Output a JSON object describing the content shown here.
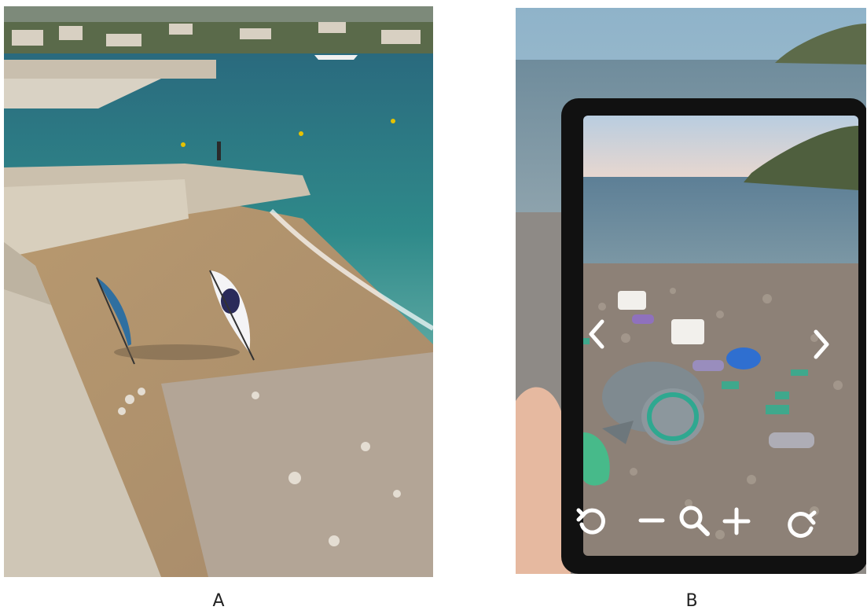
{
  "panels": [
    {
      "id": "A",
      "caption": "A",
      "description_scene": "beach-photo-with-flags"
    },
    {
      "id": "B",
      "caption": "B",
      "description_scene": "tablet-ar-view"
    }
  ],
  "ar_controls": {
    "prev_icon": "chevron-left-icon",
    "next_icon": "chevron-right-icon",
    "rotate_left_icon": "rotate-ccw-icon",
    "zoom_out_icon": "minus-icon",
    "zoom_icon": "magnifier-icon",
    "zoom_in_icon": "plus-icon",
    "rotate_right_icon": "rotate-cw-icon",
    "control_color": "#ffffff"
  },
  "colors": {
    "sea_deep": "#1f5f73",
    "sea_shallow": "#2f8a8a",
    "sand": "#b89a76",
    "pebbles": "#a39686",
    "stone_wall": "#cfc6b6",
    "tablet_frame": "#111111",
    "flag_blue": "#2f6fa0",
    "flag_white": "#f4f4f6",
    "seal_grey": "#7f8a90"
  }
}
